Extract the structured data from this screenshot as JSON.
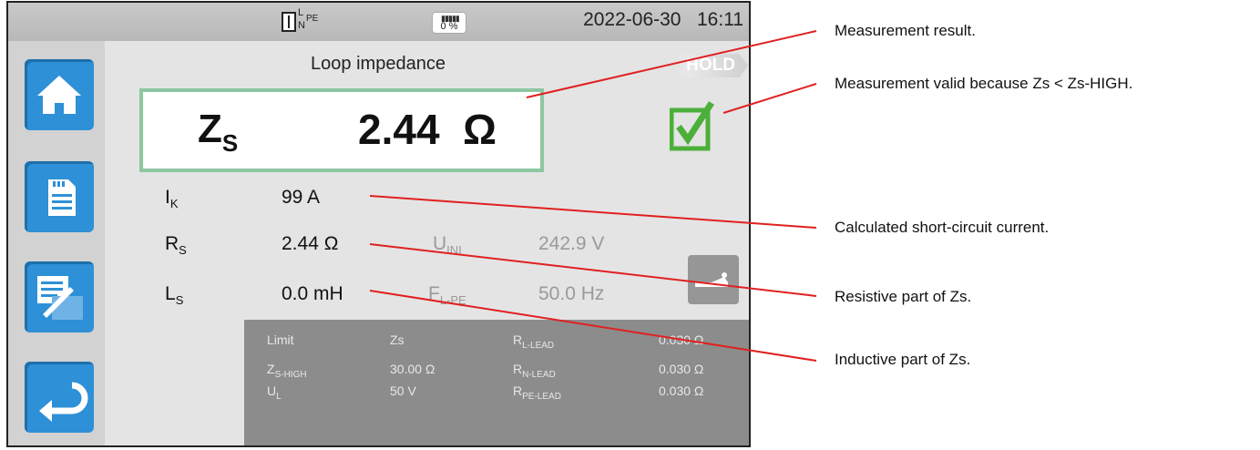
{
  "status": {
    "conn_l": "L",
    "conn_n": "N",
    "conn_pe": "PE",
    "battery": "0 %",
    "date": "2022-06-30",
    "time": "16:11"
  },
  "sidebar": {
    "items": [
      {
        "icon": "home-icon"
      },
      {
        "icon": "memory-card-icon"
      },
      {
        "icon": "report-icon"
      },
      {
        "icon": "back-arrow-icon"
      }
    ]
  },
  "screen": {
    "title": "Loop impedance",
    "hold": "HOLD",
    "zs_label": "Z",
    "zs_sub": "S",
    "zs_value": "2.44",
    "zs_unit": "Ω",
    "ik_label": "I",
    "ik_sub": "K",
    "ik_value": "99 A",
    "rs_label": "R",
    "rs_sub": "S",
    "rs_value": "2.44 Ω",
    "ls_label": "L",
    "ls_sub": "S",
    "ls_value": "0.0 mH",
    "uini_label": "U",
    "uini_sub": "INI",
    "uini_value": "242.9 V",
    "flpe_label": "F",
    "flpe_sub": "L-PE",
    "flpe_value": "50.0 Hz"
  },
  "limits": {
    "c1": [
      "Limit",
      "Z",
      "U"
    ],
    "c1_sub": [
      "",
      "S-HIGH",
      "L"
    ],
    "c2": [
      "Zs",
      "30.00 Ω",
      "50 V"
    ],
    "c3": [
      "R",
      "R",
      "R"
    ],
    "c3_sub": [
      "L-LEAD",
      "N-LEAD",
      "PE-LEAD"
    ],
    "c4": [
      "0.030 Ω",
      "0.030 Ω",
      "0.030 Ω"
    ]
  },
  "callouts": [
    "Measurement result.",
    "Measurement valid because Zs < Zs-HIGH.",
    "Calculated short-circuit current.",
    "Resistive part of Zs.",
    "Inductive part of Zs."
  ],
  "colors": {
    "sidebar_button": "#2e90d6",
    "result_border": "#8dc7a1",
    "valid_check": "#4caf3a",
    "callout_line": "#e02020"
  }
}
